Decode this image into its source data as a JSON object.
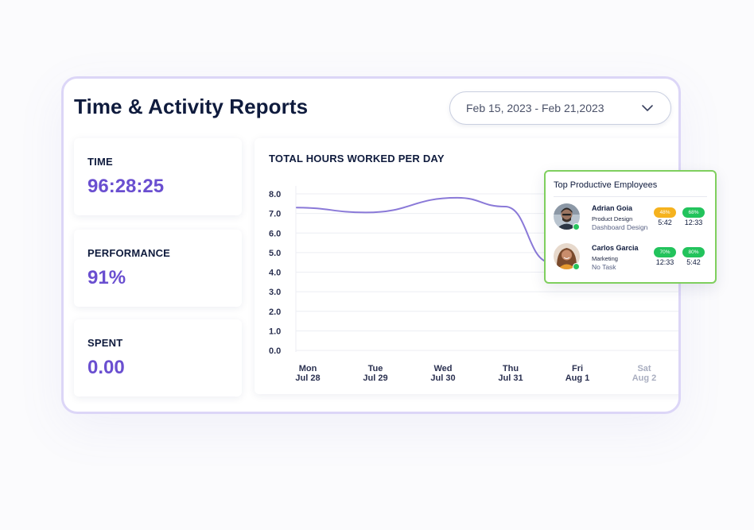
{
  "header": {
    "title": "Time & Activity Reports",
    "date_range": "Feb 15, 2023 - Feb 21,2023"
  },
  "stats": [
    {
      "label": "TIME",
      "value": "96:28:25"
    },
    {
      "label": "PERFORMANCE",
      "value": "91%"
    },
    {
      "label": "SPENT",
      "value": "0.00"
    }
  ],
  "chart_title": "TOTAL HOURS WORKED PER DAY",
  "chart_data": {
    "type": "line",
    "title": "TOTAL HOURS WORKED PER DAY",
    "xlabel": "",
    "ylabel": "",
    "y_ticks": [
      "8.0",
      "7.0",
      "6.0",
      "5.0",
      "4.0",
      "3.0",
      "2.0",
      "1.0",
      "0.0"
    ],
    "categories": [
      {
        "day": "Mon",
        "date": "Jul 28"
      },
      {
        "day": "Tue",
        "date": "Jul 29"
      },
      {
        "day": "Wed",
        "date": "Jul 30"
      },
      {
        "day": "Thu",
        "date": "Jul 31"
      },
      {
        "day": "Fri",
        "date": "Aug 1"
      },
      {
        "day": "Sat",
        "date": "Aug 2"
      }
    ],
    "series": [
      {
        "values": [
          7.3,
          7.05,
          7.8,
          7.35,
          4.5
        ]
      }
    ],
    "ylim": [
      0,
      8
    ],
    "grid": true,
    "colors": {
      "line": "#8a79d8",
      "grid": "#eceef3",
      "axis_label": "#2a3050",
      "disabled_label": "#a9aec0"
    }
  },
  "popup": {
    "title": "Top Productive Employees",
    "employees": [
      {
        "name": "Adrian Goia",
        "department": "Product Design",
        "task": "Dashboard Design",
        "stats": [
          {
            "percent": "48%",
            "time": "5:42",
            "color": "#f5b21e"
          },
          {
            "percent": "68%",
            "time": "12:33",
            "color": "#22c35c"
          }
        ]
      },
      {
        "name": "Carlos Garcia",
        "department": "Marketing",
        "task": "No Task",
        "stats": [
          {
            "percent": "70%",
            "time": "12:33",
            "color": "#22c35c"
          },
          {
            "percent": "80%",
            "time": "5:42",
            "color": "#22c35c"
          }
        ]
      }
    ]
  },
  "colors": {
    "accent": "#6a4fd0",
    "window_border": "#dcd6f7",
    "popup_border": "#7fcf5e",
    "online": "#27c45d"
  }
}
